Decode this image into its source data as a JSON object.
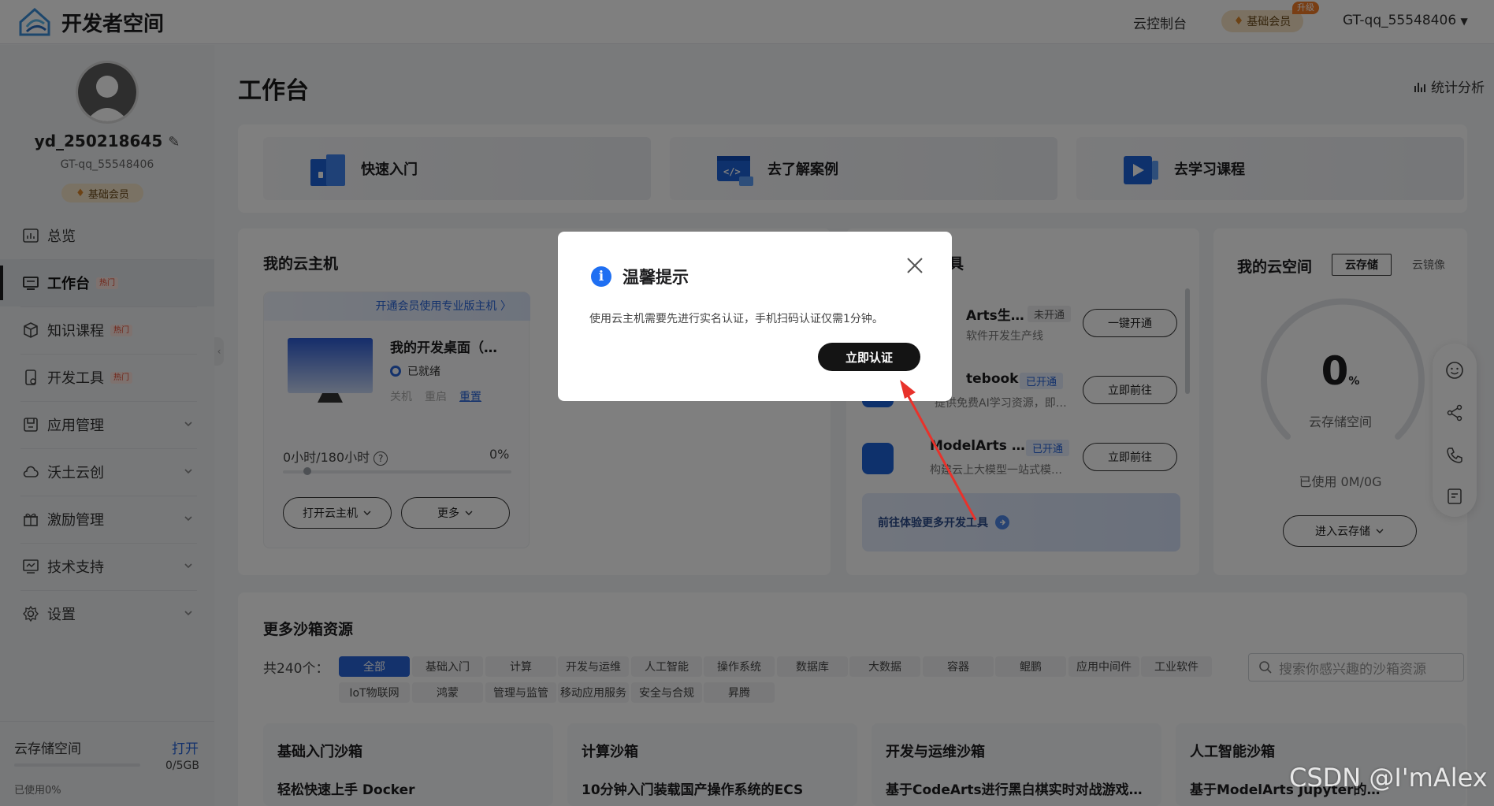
{
  "topbar": {
    "brand": "开发者空间",
    "console": "云控制台",
    "vip": "基础会员",
    "vip_tag": "升级",
    "user": "GT-qq_55548406"
  },
  "sidebar": {
    "username": "yd_250218645",
    "account": "GT-qq_55548406",
    "membership": "基础会员",
    "nav": [
      {
        "label": "总览",
        "icon": "overview-icon"
      },
      {
        "label": "工作台",
        "icon": "workbench-icon",
        "hot": "热门",
        "active": true
      },
      {
        "label": "知识课程",
        "icon": "cube-icon",
        "hot": "热门"
      },
      {
        "label": "开发工具",
        "icon": "phone-tool-icon",
        "hot": "热门"
      },
      {
        "label": "应用管理",
        "icon": "app-icon"
      },
      {
        "label": "沃土云创",
        "icon": "cloud-icon"
      },
      {
        "label": "激励管理",
        "icon": "gift-icon"
      },
      {
        "label": "技术支持",
        "icon": "support-icon"
      },
      {
        "label": "设置",
        "icon": "gear-icon"
      }
    ],
    "storage": {
      "label": "云存储空间",
      "open": "打开",
      "size": "0/5GB",
      "used": "已使用0%",
      "fraction": 0
    }
  },
  "main": {
    "title": "工作台",
    "stats": "统计分析",
    "quick": [
      "快速入门",
      "去了解案例",
      "去学习课程"
    ],
    "host": {
      "title": "我的云主机",
      "promo": "开通会员使用专业版主机 〉",
      "name": "我的开发桌面（…",
      "status": "已就绪",
      "actions": [
        "关机",
        "重启",
        "重置"
      ],
      "usage": "0小时/180小时",
      "usage_pct": "0%",
      "usage_fraction": 0,
      "open_btn": "打开云主机",
      "more_btn": "更多"
    },
    "tools": {
      "title_suffix": "具",
      "items": [
        {
          "name": "Arts生…",
          "state": "未开通",
          "desc": "软件开发生产线",
          "btn": "一键开通"
        },
        {
          "name": "tebook",
          "state": "已开通",
          "desc": "提供免费AI学习资源，即…",
          "btn": "立即前往"
        },
        {
          "name": "ModelArts …",
          "state": "已开通",
          "desc": "构建云上大模型一站式模…",
          "btn": "立即前往"
        }
      ],
      "more": "前往体验更多开发工具"
    },
    "cloud": {
      "title": "我的云空间",
      "tab_active": "云存储",
      "tab_other": "云镜像",
      "value": "0",
      "unit": "%",
      "label": "云存储空间",
      "used": "已使用   0M/0G",
      "btn": "进入云存储"
    },
    "sandbox": {
      "title": "更多沙箱资源",
      "count": "共240个：",
      "chips": [
        "全部",
        "基础入门",
        "计算",
        "开发与运维",
        "人工智能",
        "操作系统",
        "数据库",
        "大数据",
        "容器",
        "鲲鹏",
        "应用中间件",
        "工业软件",
        "IoT物联网",
        "鸿蒙",
        "管理与监管",
        "移动应用服务",
        "安全与合规",
        "昇腾"
      ],
      "search_placeholder": "搜索你感兴趣的沙箱资源",
      "cards": [
        {
          "title": "基础入门沙箱",
          "item": "轻松快速上手 Docker"
        },
        {
          "title": "计算沙箱",
          "item": "10分钟入门装载国产操作系统的ECS"
        },
        {
          "title": "开发与运维沙箱",
          "item": "基于CodeArts进行黑白棋实时对战游戏…"
        },
        {
          "title": "人工智能沙箱",
          "item": "基于ModelArts Jupyter的…"
        }
      ]
    }
  },
  "modal": {
    "title": "温馨提示",
    "body": "使用云主机需要先进行实名认证，手机扫码认证仅需1分钟。",
    "confirm": "立即认证"
  },
  "watermark": "CSDN @I'mAlex",
  "colors": {
    "primary": "#2864d9",
    "info": "#1f6ff2",
    "arrow": "#e8322b",
    "dark_button": "#141414"
  }
}
